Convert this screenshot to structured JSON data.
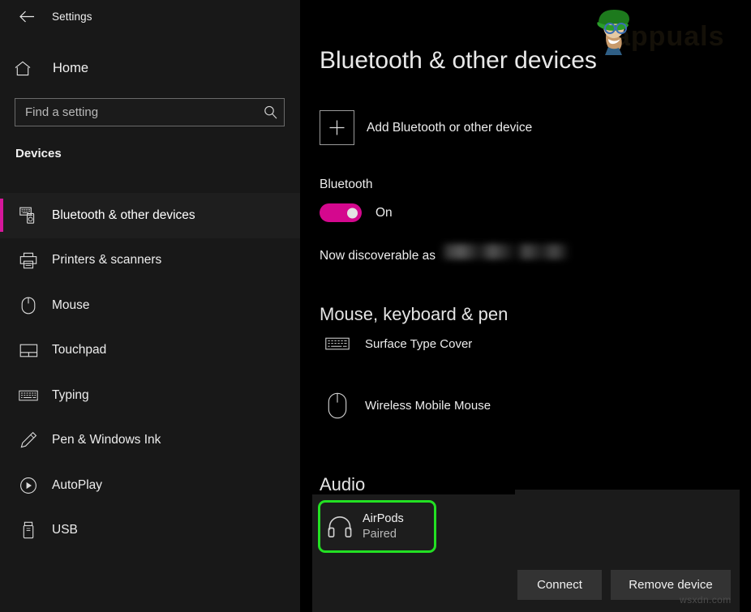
{
  "window": {
    "title": "Settings",
    "back_icon": "back-arrow-icon"
  },
  "sidebar": {
    "home": {
      "label": "Home",
      "icon": "home-icon"
    },
    "search": {
      "placeholder": "Find a setting",
      "value": "",
      "icon": "search-icon"
    },
    "section_label": "Devices",
    "accent_color": "#d6179b",
    "items": [
      {
        "label": "Bluetooth & other devices",
        "icon": "bluetooth-devices-icon",
        "selected": true
      },
      {
        "label": "Printers & scanners",
        "icon": "printer-icon",
        "selected": false
      },
      {
        "label": "Mouse",
        "icon": "mouse-icon",
        "selected": false
      },
      {
        "label": "Touchpad",
        "icon": "touchpad-icon",
        "selected": false
      },
      {
        "label": "Typing",
        "icon": "keyboard-icon",
        "selected": false
      },
      {
        "label": "Pen & Windows Ink",
        "icon": "pen-icon",
        "selected": false
      },
      {
        "label": "AutoPlay",
        "icon": "autoplay-icon",
        "selected": false
      },
      {
        "label": "USB",
        "icon": "usb-icon",
        "selected": false
      }
    ]
  },
  "main": {
    "page_title": "Bluetooth & other devices",
    "add_device": {
      "label": "Add Bluetooth or other device",
      "icon": "plus-icon"
    },
    "bluetooth": {
      "label": "Bluetooth",
      "toggle_state": "On",
      "toggle_on": true,
      "toggle_color": "#d4088e"
    },
    "discoverable": {
      "prefix": "Now discoverable as",
      "device_name_redacted": true
    },
    "groups": [
      {
        "heading": "Mouse, keyboard & pen",
        "devices": [
          {
            "name": "Surface Type Cover",
            "icon": "keyboard-icon"
          },
          {
            "name": "Wireless Mobile Mouse",
            "icon": "mouse-icon"
          }
        ]
      },
      {
        "heading": "Audio",
        "devices": [
          {
            "name": "AirPods",
            "status": "Paired",
            "icon": "headphones-icon",
            "selected": true,
            "highlight_color": "#23e023"
          }
        ]
      }
    ],
    "actions": [
      {
        "label": "Connect",
        "name": "connect-button"
      },
      {
        "label": "Remove device",
        "name": "remove-device-button"
      }
    ]
  },
  "watermarks": {
    "logo_text": "appuals",
    "bottom_text": "wsxdn.com"
  }
}
